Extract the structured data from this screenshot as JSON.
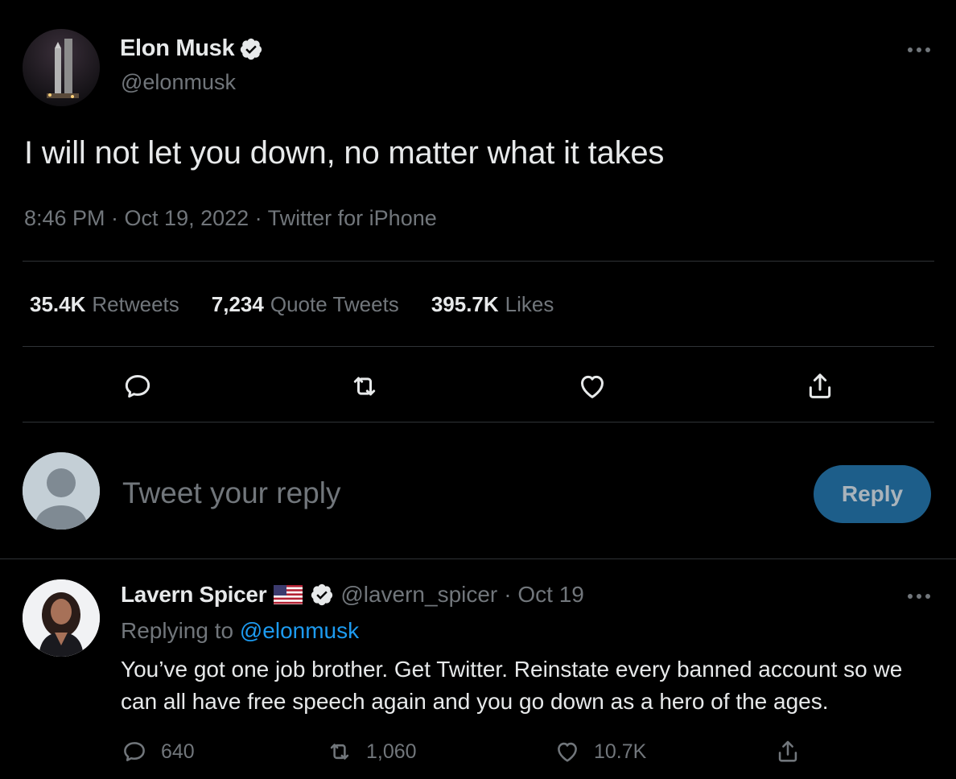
{
  "tweet": {
    "author_name": "Elon Musk",
    "author_handle": "@elonmusk",
    "text": "I will not let you down, no matter what it takes",
    "meta": "8:46 PM · Oct 19, 2022 · Twitter for iPhone",
    "stats": {
      "retweets_count": "35.4K",
      "retweets_label": "Retweets",
      "quotes_count": "7,234",
      "quotes_label": "Quote Tweets",
      "likes_count": "395.7K",
      "likes_label": "Likes"
    },
    "actions": [
      "reply-icon",
      "retweet-icon",
      "like-icon",
      "share-icon"
    ]
  },
  "composer": {
    "placeholder": "Tweet your reply",
    "reply_label": "Reply"
  },
  "reply": {
    "author_name": "Lavern Spicer",
    "author_handle": "@lavern_spicer",
    "date": "· Oct 19",
    "replying_prefix": "Replying to",
    "replying_handle": "@elonmusk",
    "text": "You’ve got one job brother. Get Twitter. Reinstate every banned account so we can all have free speech again and you go down as a hero of the ages.",
    "counts": {
      "replies": "640",
      "retweets": "1,060",
      "likes": "10.7K"
    }
  },
  "colors": {
    "background": "#000000",
    "text_primary": "#e7e9ea",
    "text_secondary": "#71767b",
    "accent": "#1d9bf0",
    "divider": "#2f3336",
    "reply_button_bg": "#1d5e8a"
  }
}
